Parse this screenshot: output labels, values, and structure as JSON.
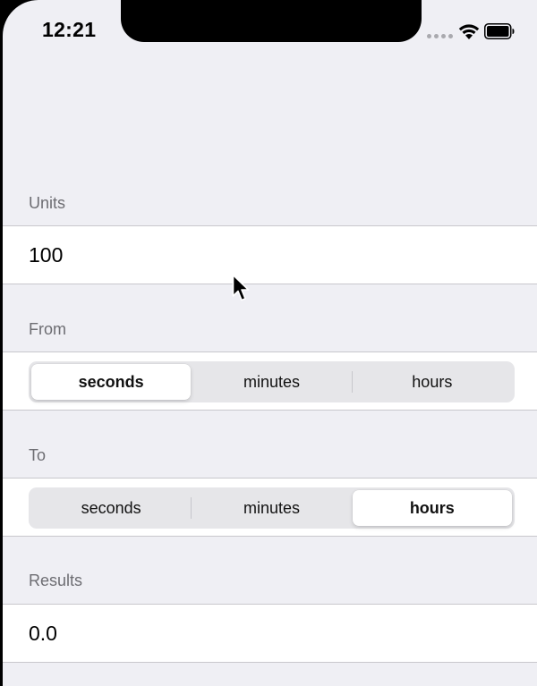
{
  "status_bar": {
    "time": "12:21"
  },
  "sections": {
    "units": {
      "header": "Units",
      "value": "100"
    },
    "from": {
      "header": "From",
      "options": [
        "seconds",
        "minutes",
        "hours"
      ],
      "selected": "seconds"
    },
    "to": {
      "header": "To",
      "options": [
        "seconds",
        "minutes",
        "hours"
      ],
      "selected": "hours"
    },
    "results": {
      "header": "Results",
      "value": "0.0"
    }
  },
  "colors": {
    "background": "#efeff4",
    "cell": "#ffffff",
    "segmented_track": "#e6e6e9",
    "header_text": "#6d6d72"
  },
  "icons": [
    "signal-icon",
    "wifi-icon",
    "battery-icon",
    "cursor-icon"
  ]
}
